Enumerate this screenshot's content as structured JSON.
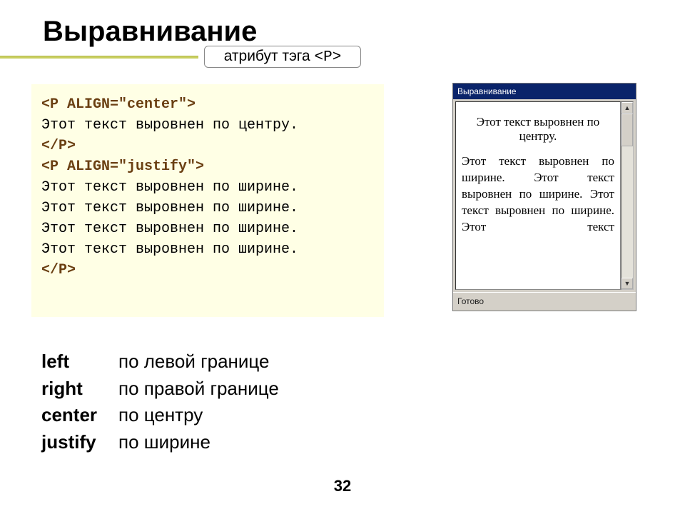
{
  "title": "Выравнивание",
  "callout": {
    "prefix": "атрибут тэга ",
    "tag": "<P>"
  },
  "code": {
    "line1_tag": "<P ALIGN=\"center\">",
    "line2": "Этот текст выровнен по центру.",
    "line3_tag": "</P>",
    "line4_tag": "<P ALIGN=\"justify\">",
    "line5": "Этот текст выровнен по ширине.",
    "line6": "Этот текст выровнен по ширине.",
    "line7": "Этот текст выровнен по ширине.",
    "line8": "Этот текст выровнен по ширине.",
    "line9_tag": "</P>"
  },
  "browser": {
    "title": "Выравнивание",
    "status": "Готово",
    "p_center": "Этот текст выровнен по центру.",
    "p_justify": "Этот текст выровнен по ширине. Этот текст выровнен по ширине. Этот текст выровнен по ширине. Этот текст"
  },
  "defs": {
    "left": {
      "term": "left",
      "desc": "по левой границе"
    },
    "right": {
      "term": "right",
      "desc": "по правой границе"
    },
    "center": {
      "term": "center",
      "desc": "по центру"
    },
    "justify": {
      "term": "justify",
      "desc": "по ширине"
    }
  },
  "page_number": "32"
}
